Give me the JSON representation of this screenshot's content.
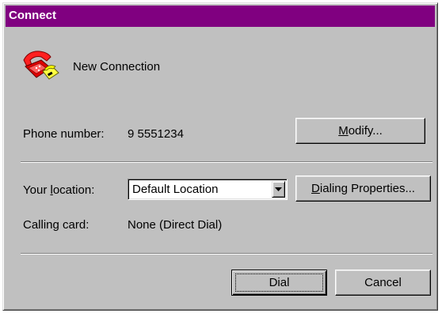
{
  "window": {
    "title": "Connect"
  },
  "connection": {
    "name": "New Connection",
    "icon": "telephone-icon"
  },
  "phone": {
    "label": "Phone number:",
    "value": "9 5551234",
    "modify_pre": "",
    "modify_u": "M",
    "modify_post": "odify..."
  },
  "location": {
    "label_pre": "Your ",
    "label_u": "l",
    "label_post": "ocation:",
    "selected": "Default Location",
    "dialing_pre": "",
    "dialing_u": "D",
    "dialing_post": "ialing Properties..."
  },
  "calling_card": {
    "label": "Calling card:",
    "value": "None (Direct Dial)"
  },
  "buttons": {
    "dial": "Dial",
    "cancel": "Cancel"
  },
  "colors": {
    "titlebar": "#800080",
    "face": "#c0c0c0"
  }
}
